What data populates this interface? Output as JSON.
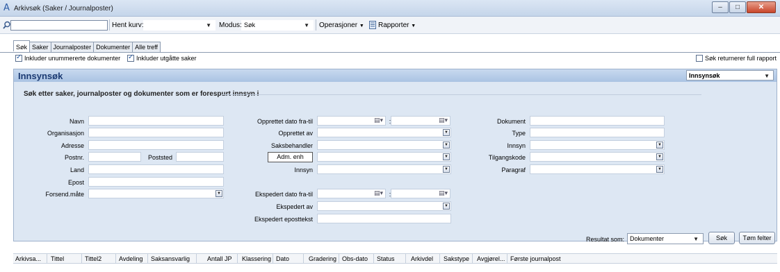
{
  "window": {
    "title": "Arkivsøk (Saker / Journalposter)",
    "app_icon": "A"
  },
  "toolbar": {
    "search_value": "",
    "hent_kurv_label": "Hent kurv:",
    "hent_kurv_value": "",
    "modus_label": "Modus:",
    "modus_value": "Søk",
    "operasjoner_label": "Operasjoner",
    "rapporter_label": "Rapporter"
  },
  "tabs": [
    "Søk",
    "Saker",
    "Journalposter",
    "Dokumenter",
    "Alle treff"
  ],
  "options": {
    "include_unnumbered": "Inkluder unummererte dokumenter",
    "include_expired": "Inkluder utgåtte saker",
    "full_report": "Søk returnerer full rapport"
  },
  "panel": {
    "title": "Innsynsøk",
    "mode_select": "Innsynsøk",
    "subtitle": "Søk etter saker, journalposter og dokumenter som er forespurt innsyn i"
  },
  "form": {
    "navn": "Navn",
    "organisasjon": "Organisasjon",
    "adresse": "Adresse",
    "postnr": "Postnr.",
    "poststed": "Poststed",
    "land": "Land",
    "epost": "Epost",
    "forsend_mate": "Forsend.måte",
    "opprettet_dato": "Opprettet dato fra-til",
    "opprettet_av": "Opprettet av",
    "saksbehandler": "Saksbehandler",
    "adm_enh": "Adm. enh",
    "innsyn_mid": "Innsyn",
    "ekspedert_dato": "Ekspedert dato fra-til",
    "ekspedert_av": "Ekspedert av",
    "ekspedert_eposttekst": "Ekspedert eposttekst",
    "dokument": "Dokument",
    "type": "Type",
    "innsyn_right": "Innsyn",
    "tilgangskode": "Tilgangskode",
    "paragraf": "Paragraf",
    "colon": ":"
  },
  "result": {
    "label": "Resultat som:",
    "value": "Dokumenter",
    "search_button": "Søk",
    "clear_button": "Tøm felter"
  },
  "columns": [
    "Arkivsa...",
    "Tittel",
    "Tittel2",
    "Avdeling",
    "Saksansvarlig",
    "Antall JP",
    "Klassering",
    "Dato",
    "Gradering",
    "Obs-dato",
    "Status",
    "Arkivdel",
    "Sakstype",
    "Avgjørel...",
    "Første journalpost"
  ],
  "colors": {
    "panel_bg": "#dde7f3",
    "title_color": "#1b3a72"
  }
}
